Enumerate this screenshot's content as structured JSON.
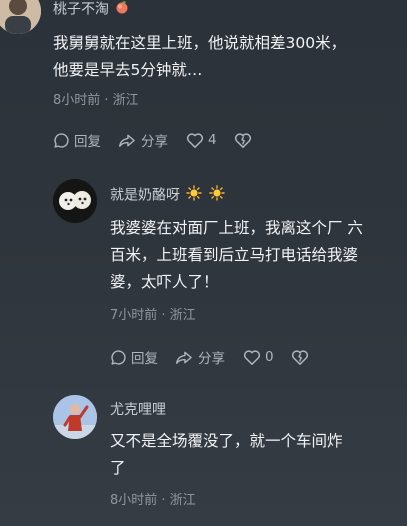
{
  "comments": [
    {
      "username": "桃子不淘",
      "username_emoji": "peach-emoji",
      "text_line1": "我舅舅就在这里上班，他说就相差300米，",
      "text_line2": "他要是早去5分钟就…",
      "meta": "8小时前 · 浙江"
    },
    {
      "username": "就是奶酪呀",
      "username_emoji": "sun-emoji",
      "text_line1": "我婆婆在对面厂上班，我离这个厂 六",
      "text_line2": "百米，上班看到后立马打电话给我婆",
      "text_line3": "婆，太吓人了！",
      "meta": "7小时前 · 浙江"
    },
    {
      "username": "尤克哩哩",
      "text_line1": "又不是全场覆没了，就一个车间炸",
      "text_line2": "了",
      "meta": "8小时前 · 浙江"
    }
  ],
  "actions": {
    "reply": "回复",
    "share": "分享",
    "like_count_1": "4",
    "like_count_2": "0"
  },
  "colors": {
    "background": "#2f353c",
    "text": "#f1f3f5",
    "username": "#c7ced4",
    "meta": "#8f979e",
    "action": "#aeb5bb"
  }
}
